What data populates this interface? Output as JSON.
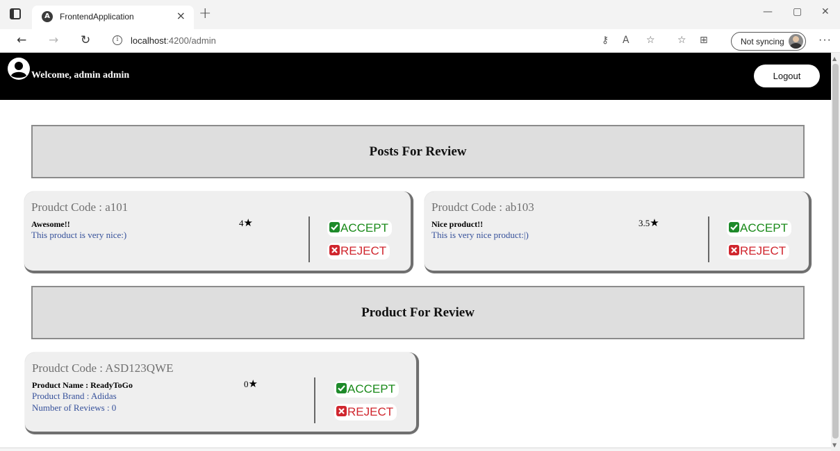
{
  "browser": {
    "tab_title": "FrontendApplication",
    "tab_favicon": "angular-icon",
    "new_tab_label": "+",
    "close_tab_label": "×",
    "url_host": "localhost",
    "url_path": ":4200/admin",
    "profile_label": "Not syncing",
    "more_label": "···"
  },
  "header": {
    "welcome_text": "Welcome, admin admin",
    "logout_label": "Logout",
    "background_color": "#000000"
  },
  "sections": {
    "posts_title": "Posts For Review",
    "products_title": "Product For Review"
  },
  "posts": [
    {
      "code": "Proudct Code : a101",
      "title": "Awesome!!",
      "body": "This product is very nice:)",
      "rating": "4",
      "accept_label": "ACCEPT",
      "reject_label": "REJECT"
    },
    {
      "code": "Proudct Code : ab103",
      "title": "Nice product!!",
      "body": "This is very nice product:|)",
      "rating": "3.5",
      "accept_label": "ACCEPT",
      "reject_label": "REJECT"
    }
  ],
  "products": [
    {
      "code": "Proudct Code : ASD123QWE",
      "name": "Product Name : ReadyToGo",
      "brand": "Product Brand : Adidas",
      "reviews": "Number of Reviews : 0",
      "rating": "0",
      "accept_label": "ACCEPT",
      "reject_label": "REJECT"
    }
  ],
  "colors": {
    "accept": "#1a8a1a",
    "reject": "#d0262e",
    "card_background": "#efefef",
    "section_background": "#dedede",
    "link_text": "#35509a"
  }
}
